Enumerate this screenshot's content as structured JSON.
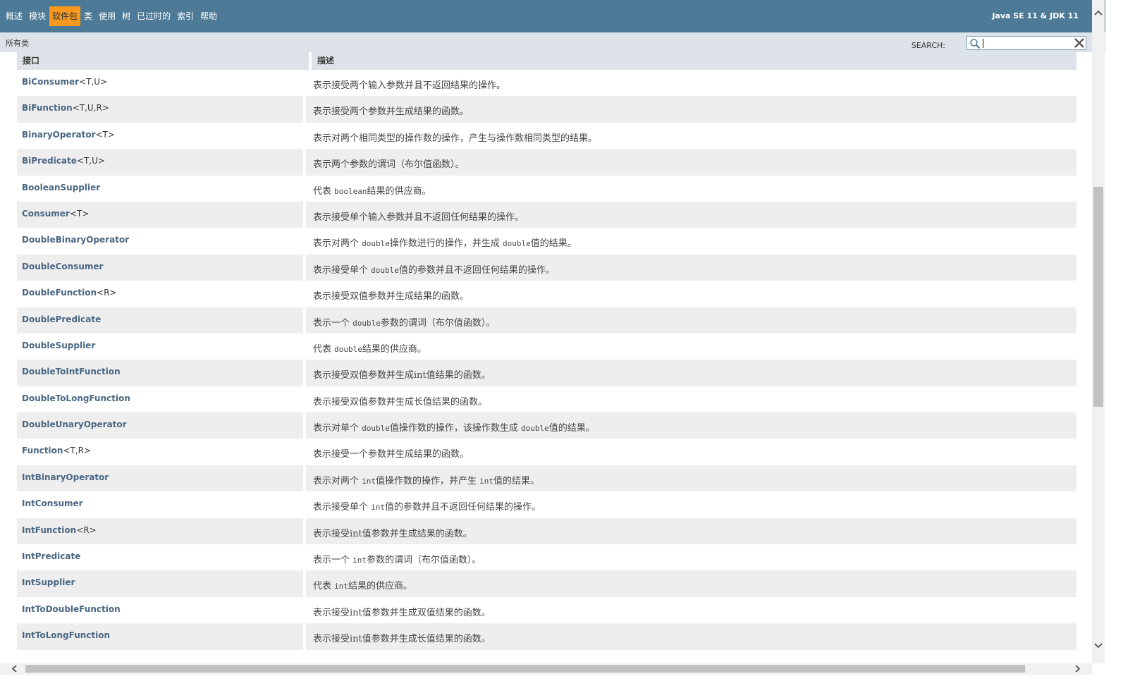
{
  "topnav": {
    "items": [
      {
        "label": "概述"
      },
      {
        "label": "模块"
      },
      {
        "label": "软件包",
        "active": true
      },
      {
        "label": "类"
      },
      {
        "label": "使用"
      },
      {
        "label": "树"
      },
      {
        "label": "已过时的"
      },
      {
        "label": "索引"
      },
      {
        "label": "帮助"
      }
    ],
    "about": "Java SE 11 & JDK 11",
    "bg_color": "#4d7a97",
    "active_color": "#f8981d"
  },
  "subnav": {
    "all_classes": "所有类",
    "search_label": "SEARCH:",
    "search_value": ""
  },
  "table": {
    "headers": [
      "接口",
      "描述"
    ],
    "rows": [
      {
        "name": "BiConsumer",
        "params": "<T,U>",
        "desc": [
          {
            "t": "表示接受两个输入参数并且不返回结果的操作。"
          }
        ]
      },
      {
        "name": "BiFunction",
        "params": "<T,U,R>",
        "desc": [
          {
            "t": "表示接受两个参数并生成结果的函数。"
          }
        ]
      },
      {
        "name": "BinaryOperator",
        "params": "<T>",
        "desc": [
          {
            "t": "表示对两个相同类型的操作数的操作，产生与操作数相同类型的结果。"
          }
        ]
      },
      {
        "name": "BiPredicate",
        "params": "<T,U>",
        "desc": [
          {
            "t": "表示两个参数的谓词（布尔值函数）。"
          }
        ]
      },
      {
        "name": "BooleanSupplier",
        "params": "",
        "desc": [
          {
            "t": "代表 "
          },
          {
            "c": "boolean"
          },
          {
            "t": "结果的供应商。"
          }
        ]
      },
      {
        "name": "Consumer",
        "params": "<T>",
        "desc": [
          {
            "t": "表示接受单个输入参数并且不返回任何结果的操作。"
          }
        ]
      },
      {
        "name": "DoubleBinaryOperator",
        "params": "",
        "desc": [
          {
            "t": "表示对两个 "
          },
          {
            "c": "double"
          },
          {
            "t": "操作数进行的操作，并生成 "
          },
          {
            "c": "double"
          },
          {
            "t": "值的结果。"
          }
        ]
      },
      {
        "name": "DoubleConsumer",
        "params": "",
        "desc": [
          {
            "t": "表示接受单个 "
          },
          {
            "c": "double"
          },
          {
            "t": "值的参数并且不返回任何结果的操作。"
          }
        ]
      },
      {
        "name": "DoubleFunction",
        "params": "<R>",
        "desc": [
          {
            "t": "表示接受双值参数并生成结果的函数。"
          }
        ]
      },
      {
        "name": "DoublePredicate",
        "params": "",
        "desc": [
          {
            "t": "表示一个 "
          },
          {
            "c": "double"
          },
          {
            "t": "参数的谓词（布尔值函数）。"
          }
        ]
      },
      {
        "name": "DoubleSupplier",
        "params": "",
        "desc": [
          {
            "t": "代表 "
          },
          {
            "c": "double"
          },
          {
            "t": "结果的供应商。"
          }
        ]
      },
      {
        "name": "DoubleToIntFunction",
        "params": "",
        "desc": [
          {
            "t": "表示接受双值参数并生成int值结果的函数。"
          }
        ]
      },
      {
        "name": "DoubleToLongFunction",
        "params": "",
        "desc": [
          {
            "t": "表示接受双值参数并生成长值结果的函数。"
          }
        ]
      },
      {
        "name": "DoubleUnaryOperator",
        "params": "",
        "desc": [
          {
            "t": "表示对单个 "
          },
          {
            "c": "double"
          },
          {
            "t": "值操作数的操作，该操作数生成 "
          },
          {
            "c": "double"
          },
          {
            "t": "值的结果。"
          }
        ]
      },
      {
        "name": "Function",
        "params": "<T,R>",
        "desc": [
          {
            "t": "表示接受一个参数并生成结果的函数。"
          }
        ]
      },
      {
        "name": "IntBinaryOperator",
        "params": "",
        "desc": [
          {
            "t": "表示对两个 "
          },
          {
            "c": "int"
          },
          {
            "t": "值操作数的操作，并产生 "
          },
          {
            "c": "int"
          },
          {
            "t": "值的结果。"
          }
        ]
      },
      {
        "name": "IntConsumer",
        "params": "",
        "desc": [
          {
            "t": "表示接受单个 "
          },
          {
            "c": "int"
          },
          {
            "t": "值的参数并且不返回任何结果的操作。"
          }
        ]
      },
      {
        "name": "IntFunction",
        "params": "<R>",
        "desc": [
          {
            "t": "表示接受int值参数并生成结果的函数。"
          }
        ]
      },
      {
        "name": "IntPredicate",
        "params": "",
        "desc": [
          {
            "t": "表示一个 "
          },
          {
            "c": "int"
          },
          {
            "t": "参数的谓词（布尔值函数）。"
          }
        ]
      },
      {
        "name": "IntSupplier",
        "params": "",
        "desc": [
          {
            "t": "代表 "
          },
          {
            "c": "int"
          },
          {
            "t": "结果的供应商。"
          }
        ]
      },
      {
        "name": "IntToDoubleFunction",
        "params": "",
        "desc": [
          {
            "t": "表示接受int值参数并生成双值结果的函数。"
          }
        ]
      },
      {
        "name": "IntToLongFunction",
        "params": "",
        "desc": [
          {
            "t": "表示接受int值参数并生成长值结果的函数。"
          }
        ]
      }
    ]
  }
}
